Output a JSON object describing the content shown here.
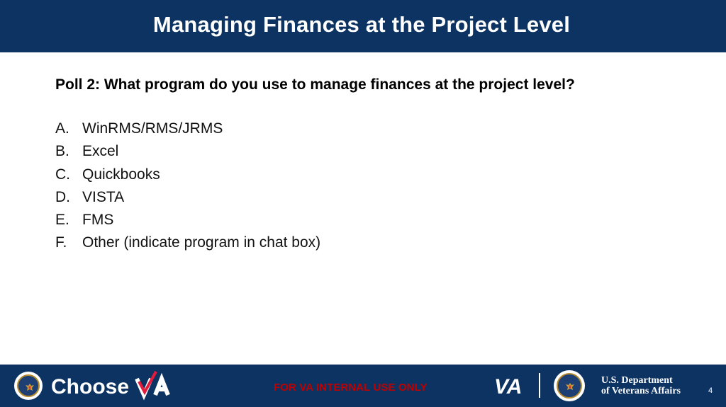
{
  "header": {
    "title": "Managing Finances at the Project Level"
  },
  "poll": {
    "question": "Poll 2:  What program do you use to manage finances at the project level?",
    "options": [
      {
        "letter": "A.",
        "text": "WinRMS/RMS/JRMS"
      },
      {
        "letter": "B.",
        "text": "Excel"
      },
      {
        "letter": "C.",
        "text": "Quickbooks"
      },
      {
        "letter": "D.",
        "text": "VISTA"
      },
      {
        "letter": "E.",
        "text": "FMS"
      },
      {
        "letter": "F.",
        "text": "Other (indicate program in chat box)"
      }
    ]
  },
  "footer": {
    "brand_logo": "ChooseVA",
    "classification": "FOR VA INTERNAL USE ONLY",
    "va_logo": "VA",
    "department_line1": "U.S. Department",
    "department_line2": "of Veterans Affairs",
    "page_number": "4"
  },
  "colors": {
    "navy": "#0c3362",
    "warning_red": "#c00000",
    "va_red": "#e31c3d"
  }
}
